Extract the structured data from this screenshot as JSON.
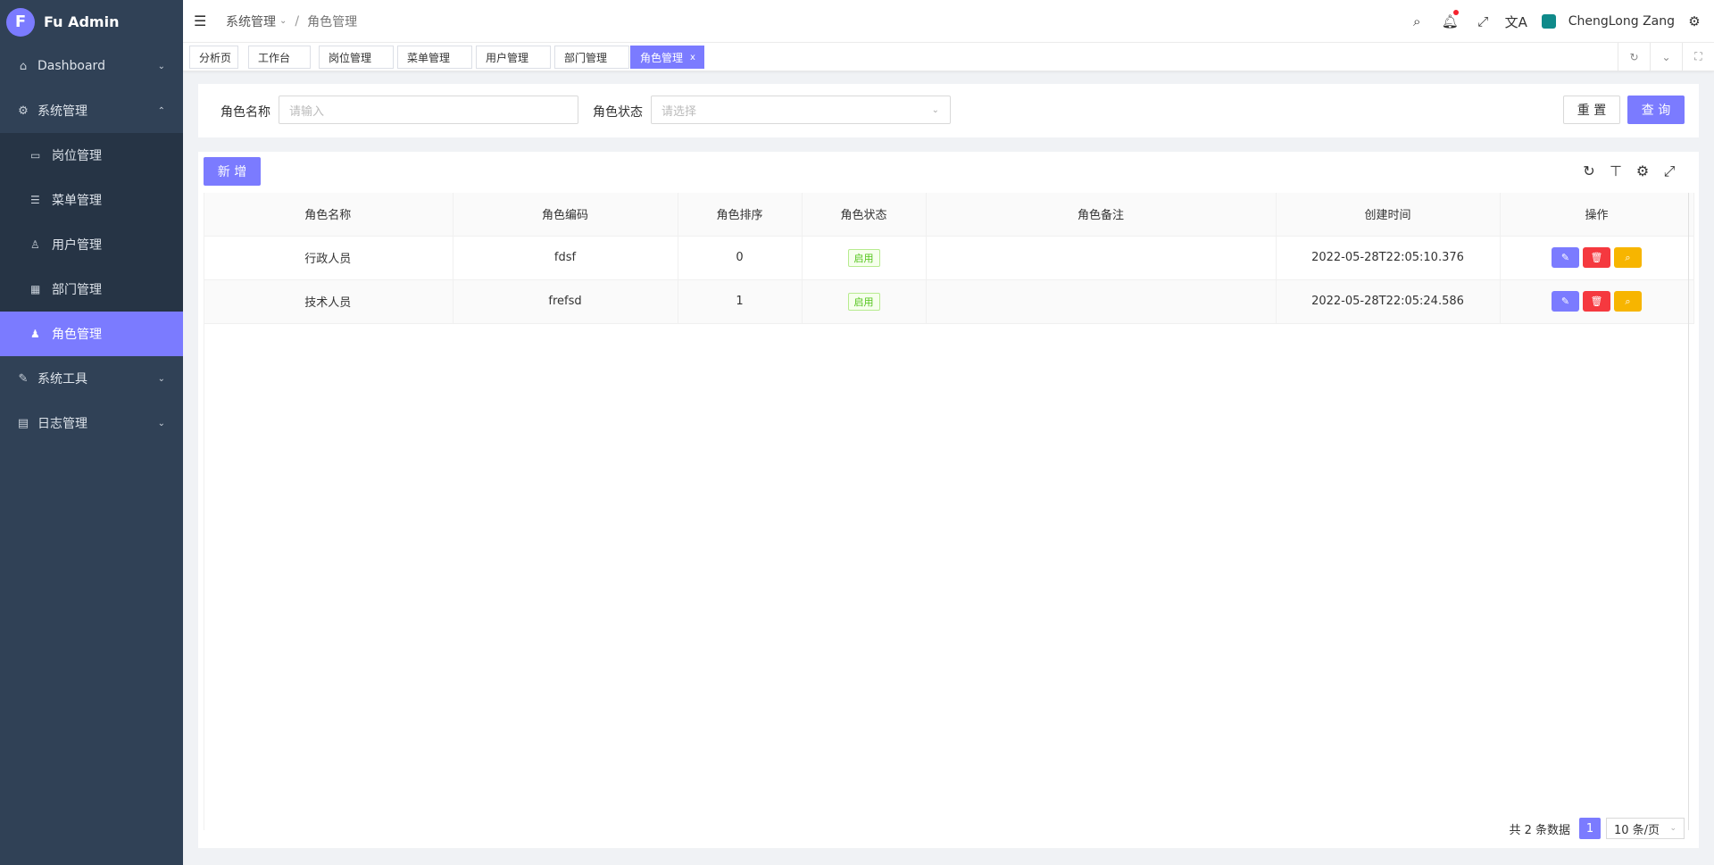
{
  "brand": {
    "logo_letter": "F",
    "name": "Fu Admin",
    "accent": "#7b7bff",
    "sidebar_bg": "#304156"
  },
  "sidebar": {
    "items": [
      {
        "label": "Dashboard",
        "icon": "home-icon"
      },
      {
        "label": "系统管理",
        "icon": "gear-icon"
      },
      {
        "label": "系统工具",
        "icon": "tool-icon"
      },
      {
        "label": "日志管理",
        "icon": "log-icon"
      }
    ],
    "sub_items": [
      {
        "label": "岗位管理",
        "icon": "post-icon"
      },
      {
        "label": "菜单管理",
        "icon": "menu-list-icon"
      },
      {
        "label": "用户管理",
        "icon": "user-icon"
      },
      {
        "label": "部门管理",
        "icon": "department-icon"
      },
      {
        "label": "角色管理",
        "icon": "role-icon",
        "active": true
      }
    ]
  },
  "header": {
    "breadcrumb": [
      "系统管理",
      "角色管理"
    ],
    "breadcrumb_sep": "/",
    "username": "ChengLong Zang"
  },
  "tabs": [
    "分析页",
    "工作台",
    "岗位管理",
    "菜单管理",
    "用户管理",
    "部门管理",
    "角色管理"
  ],
  "active_tab_close": "x",
  "search": {
    "role_name_label": "角色名称",
    "role_name_placeholder": "请输入",
    "role_status_label": "角色状态",
    "role_status_placeholder": "请选择",
    "reset_label": "重 置",
    "query_label": "查 询"
  },
  "table": {
    "add_label": "新 增",
    "columns": [
      "角色名称",
      "角色编码",
      "角色排序",
      "角色状态",
      "角色备注",
      "创建时间",
      "操作"
    ],
    "rows": [
      {
        "name": "行政人员",
        "code": "fdsf",
        "sort": "0",
        "status": "启用",
        "remark": "",
        "created": "2022-05-28T22:05:10.376"
      },
      {
        "name": "技术人员",
        "code": "frefsd",
        "sort": "1",
        "status": "启用",
        "remark": "",
        "created": "2022-05-28T22:05:24.586"
      }
    ]
  },
  "pagination": {
    "total_text": "共 2 条数据",
    "current_page": "1",
    "page_size": "10 条/页"
  }
}
